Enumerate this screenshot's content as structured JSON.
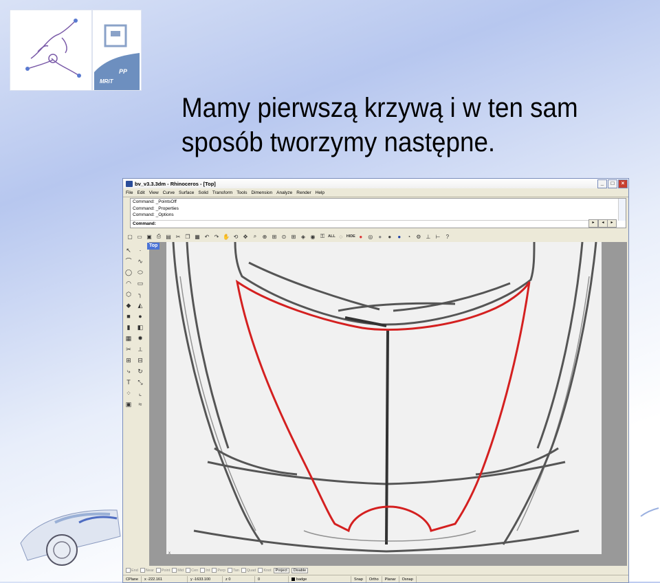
{
  "slide": {
    "title_line1": "Mamy pierwszą krzywą i w ten sam",
    "title_line2": "sposób tworzymy następne."
  },
  "window": {
    "title": "bv_v3.3.3dm - Rhinoceros - [Top]",
    "controls": {
      "minimize": "_",
      "maximize": "□",
      "close": "×"
    }
  },
  "menu": [
    "File",
    "Edit",
    "View",
    "Curve",
    "Surface",
    "Solid",
    "Transform",
    "Tools",
    "Dimension",
    "Analyze",
    "Render",
    "Help"
  ],
  "command_history": [
    "Command: _PointsOff",
    "Command: _Properties",
    "Command: _Options"
  ],
  "command_prompt": "Command:",
  "toolbar": {
    "all_label": "ALL",
    "hide_label": "HIDE"
  },
  "viewport": {
    "label": "Top",
    "axis_x": "x",
    "axis_y": "y",
    "curve_color": "#d42020"
  },
  "osnap": {
    "items": [
      "End",
      "Near",
      "Point",
      "Mid",
      "Cen",
      "Int",
      "Perp",
      "Tan",
      "Quad",
      "Knot"
    ],
    "project": "Project",
    "disable": "Disable"
  },
  "status": {
    "cplane": "CPlane",
    "x": "x -222.161",
    "y": "y -1633.100",
    "z": "z 0",
    "extra": "0",
    "layer": "badge",
    "buttons": [
      "Snap",
      "Ortho",
      "Planar",
      "Osnap"
    ]
  }
}
